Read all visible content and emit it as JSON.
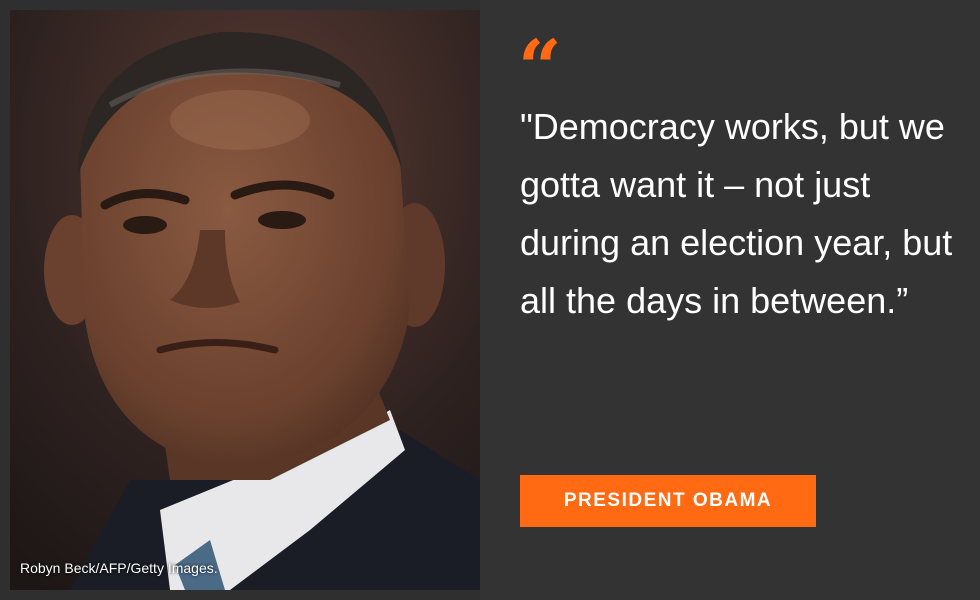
{
  "photo": {
    "credit": "Robyn Beck/AFP/Getty Images."
  },
  "quote": {
    "mark": "“",
    "text": "\"Democracy works, but we gotta want it – not just during an election year, but all the days in between.”"
  },
  "speaker": {
    "name": "PRESIDENT OBAMA"
  },
  "colors": {
    "accent": "#ff6a13",
    "panel": "#333333",
    "text": "#ffffff"
  }
}
